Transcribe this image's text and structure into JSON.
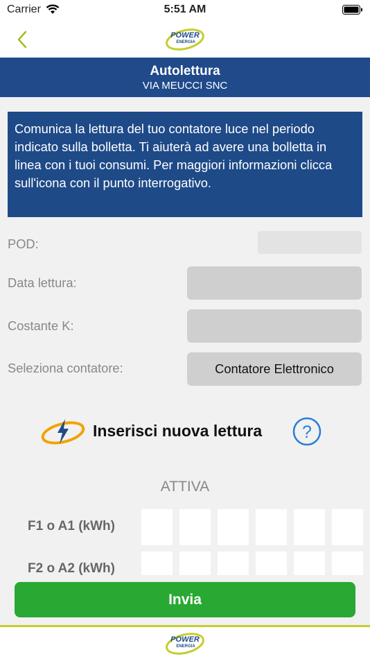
{
  "status_bar": {
    "carrier": "Carrier",
    "time": "5:51 AM"
  },
  "nav": {
    "back_icon": "chevron-left-icon",
    "logo_line1": "POWER",
    "logo_line2": "ENERGIA"
  },
  "header": {
    "title": "Autolettura",
    "subtitle": "VIA MEUCCI SNC"
  },
  "info": {
    "text": "Comunica la lettura del tuo contatore luce nel periodo indicato sulla bolletta. Ti aiuterà ad avere una bolletta in linea con i tuoi consumi. Per maggiori informazioni clicca sull'icona con il punto interrogativo."
  },
  "form": {
    "pod_label": "POD:",
    "pod_value": "",
    "date_label": "Data lettura:",
    "date_value": "",
    "k_label": "Costante K:",
    "k_value": "",
    "meter_label": "Seleziona contatore:",
    "meter_value": "Contatore Elettronico"
  },
  "new_reading": {
    "label": "Inserisci nuova lettura",
    "help_glyph": "?"
  },
  "readings": {
    "section_label": "ATTIVA",
    "row1_label": "F1 o A1 (kWh)",
    "row2_label": "F2 o A2 (kWh)"
  },
  "submit": {
    "label": "Invia"
  },
  "colors": {
    "header_blue": "#204a8a",
    "submit_green": "#29a834",
    "brand_yellow": "#c5cd2e",
    "help_blue": "#2a7dd6"
  }
}
